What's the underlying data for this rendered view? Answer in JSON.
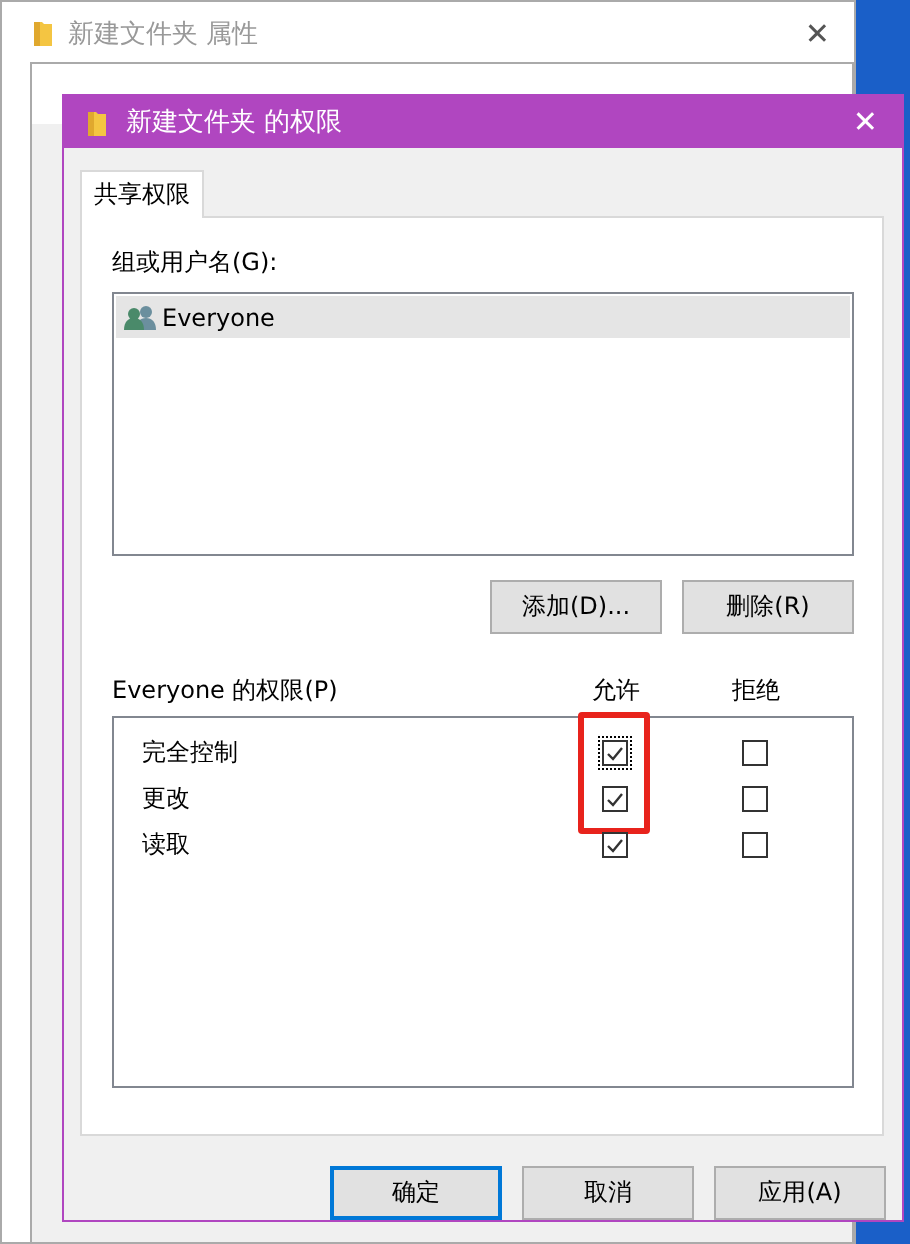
{
  "background_window": {
    "title": "新建文件夹 属性",
    "close": "✕"
  },
  "dialog": {
    "title": "新建文件夹 的权限",
    "close": "✕"
  },
  "tabs": [
    {
      "label": "共享权限",
      "selected": true
    }
  ],
  "users": {
    "label": "组或用户名(G):",
    "items": [
      {
        "name": "Everyone",
        "selected": true
      }
    ]
  },
  "user_buttons": [
    "添加(D)...",
    "删除(R)"
  ],
  "permissions": {
    "label": "Everyone 的权限(P)",
    "columns": [
      "允许",
      "拒绝"
    ],
    "rows": [
      {
        "name": "完全控制",
        "allow": true,
        "deny": false,
        "focused": true
      },
      {
        "name": "更改",
        "allow": true,
        "deny": false,
        "focused": false
      },
      {
        "name": "读取",
        "allow": true,
        "deny": false,
        "focused": false
      }
    ]
  },
  "buttons": [
    {
      "label": "确定",
      "default": true
    },
    {
      "label": "取消",
      "default": false
    },
    {
      "label": "应用(A)",
      "default": false
    }
  ]
}
